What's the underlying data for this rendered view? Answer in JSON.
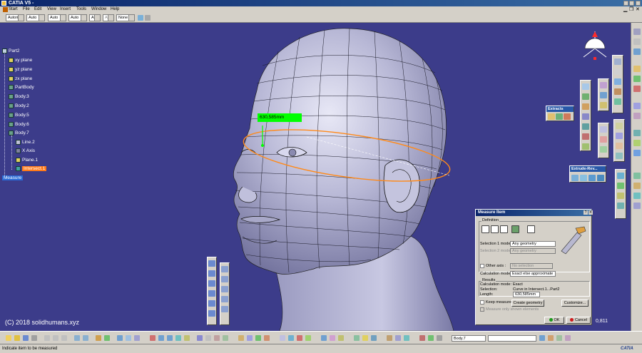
{
  "window": {
    "title": "CATIA V5 -"
  },
  "menu": [
    "Start",
    "File",
    "Edit",
    "View",
    "Insert",
    "Tools",
    "Window",
    "Help"
  ],
  "toolbar": {
    "combos": [
      "Automa",
      "Auto",
      "Auto",
      "Auto",
      "Aut",
      "Aut",
      "None"
    ]
  },
  "tree": {
    "root": "Part2",
    "items": [
      "xy plane",
      "yz plane",
      "zx plane",
      "PartBody",
      "Body.3",
      "Body.2",
      "Body.5",
      "Body.6",
      "Body.7",
      "Line.2",
      "X Axis",
      "Plane.1",
      "Intersect.1",
      "Measure"
    ]
  },
  "viewport": {
    "measure_tag": "630,585mm",
    "copyright": "(C) 2018 solidhumans.xyz",
    "scale": "0,811"
  },
  "panels": {
    "extracts": "Extracts",
    "extrude": "Extrude-Rev..."
  },
  "measure_dialog": {
    "title": "Measure Item",
    "definition": "Definition",
    "sel1_label": "Selection 1 mode:",
    "sel1_value": "Any geometry",
    "sel2_label": "Selection 2 mode:",
    "sel2_value": "Any geometry",
    "other_axis": "Other axis :",
    "no_selection": "No selection",
    "calc_mode_label": "Calculation mode :",
    "calc_mode_value": "Exact else approximate",
    "results": "Results",
    "r_calc_label": "Calculation mode:",
    "r_calc_value": "Exact",
    "r_sel_label": "Selection:",
    "r_sel_value": "Curve in Intersect.1...Part2",
    "r_len_label": "Length:",
    "r_len_value": "630,585mm",
    "keep": "Keep measure",
    "create_geom": "Create geometry",
    "customize": "Customize...",
    "only_shown": "Measure only shown elements",
    "ok": "OK",
    "cancel": "Cancel"
  },
  "bottom": {
    "combo": "Body.7",
    "status": "Indicate item to be measured",
    "brand": "CATIA"
  }
}
